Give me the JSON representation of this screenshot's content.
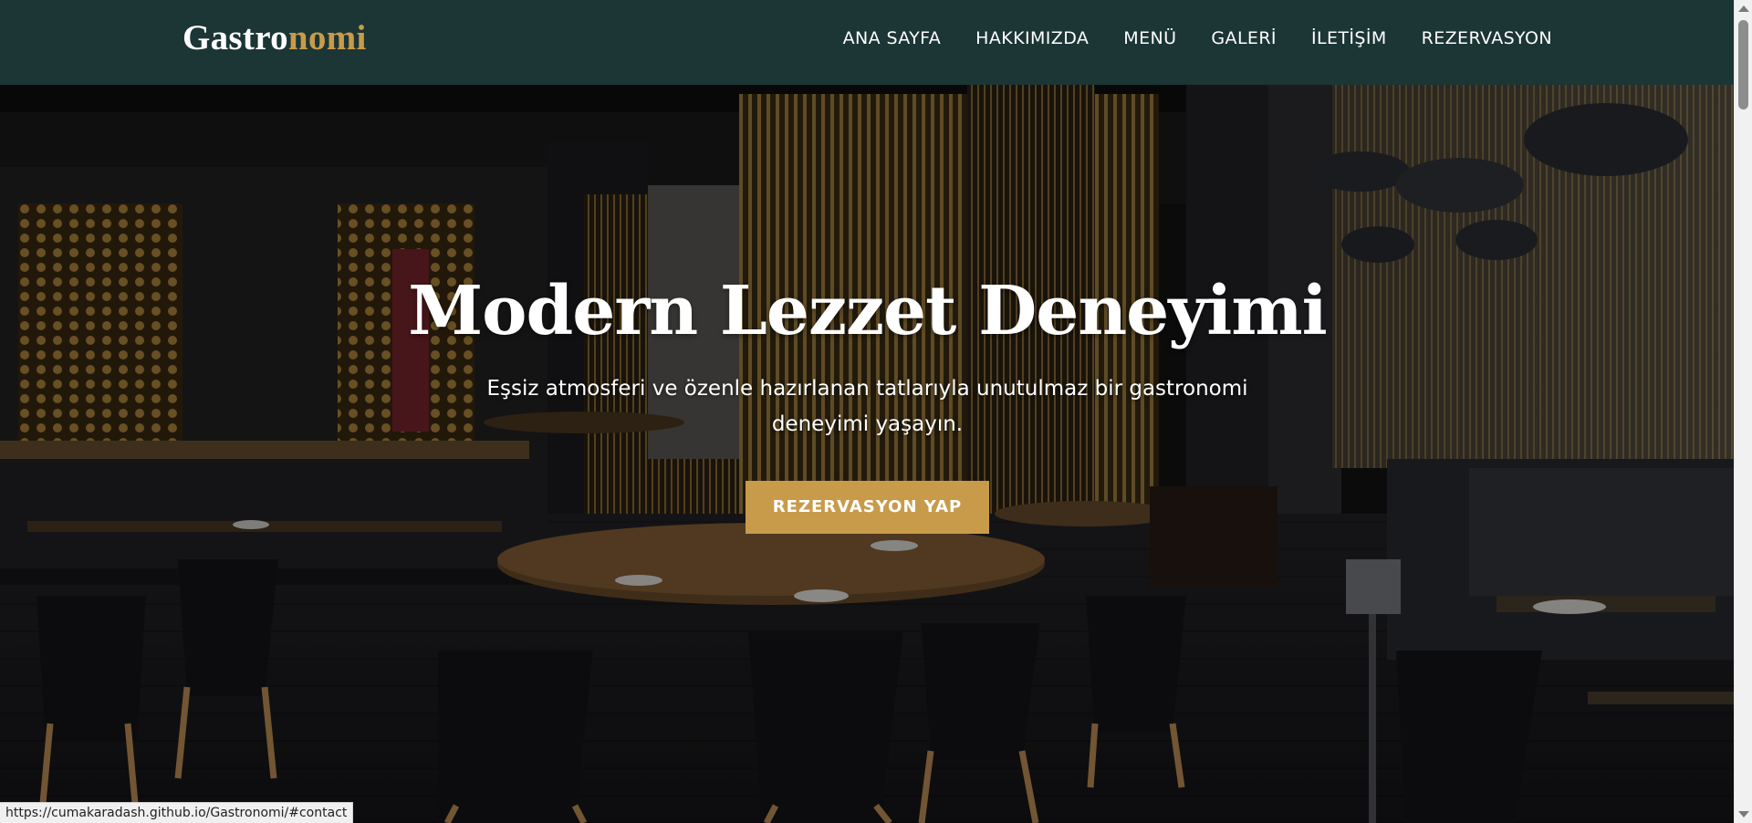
{
  "header": {
    "logo_main": "Gastro",
    "logo_accent": "nomi",
    "nav": [
      {
        "label": "ANA SAYFA"
      },
      {
        "label": "HAKKIMIZDA"
      },
      {
        "label": "MENÜ"
      },
      {
        "label": "GALERİ"
      },
      {
        "label": "İLETİŞİM"
      },
      {
        "label": "REZERVASYON"
      }
    ]
  },
  "hero": {
    "title": "Modern Lezzet Deneyimi",
    "subtitle": "Eşsiz atmosferi ve özenle hazırlanan tatlarıyla unutulmaz bir gastronomi deneyimi yaşayın.",
    "cta_label": "REZERVASYON YAP",
    "background": "restaurant-interior-photo"
  },
  "status_bar": {
    "url": "https://cumakaradash.github.io/Gastronomi/#contact"
  },
  "colors": {
    "header_bg": "#1c3535",
    "accent": "#c89b4b",
    "text_light": "#ffffff"
  }
}
